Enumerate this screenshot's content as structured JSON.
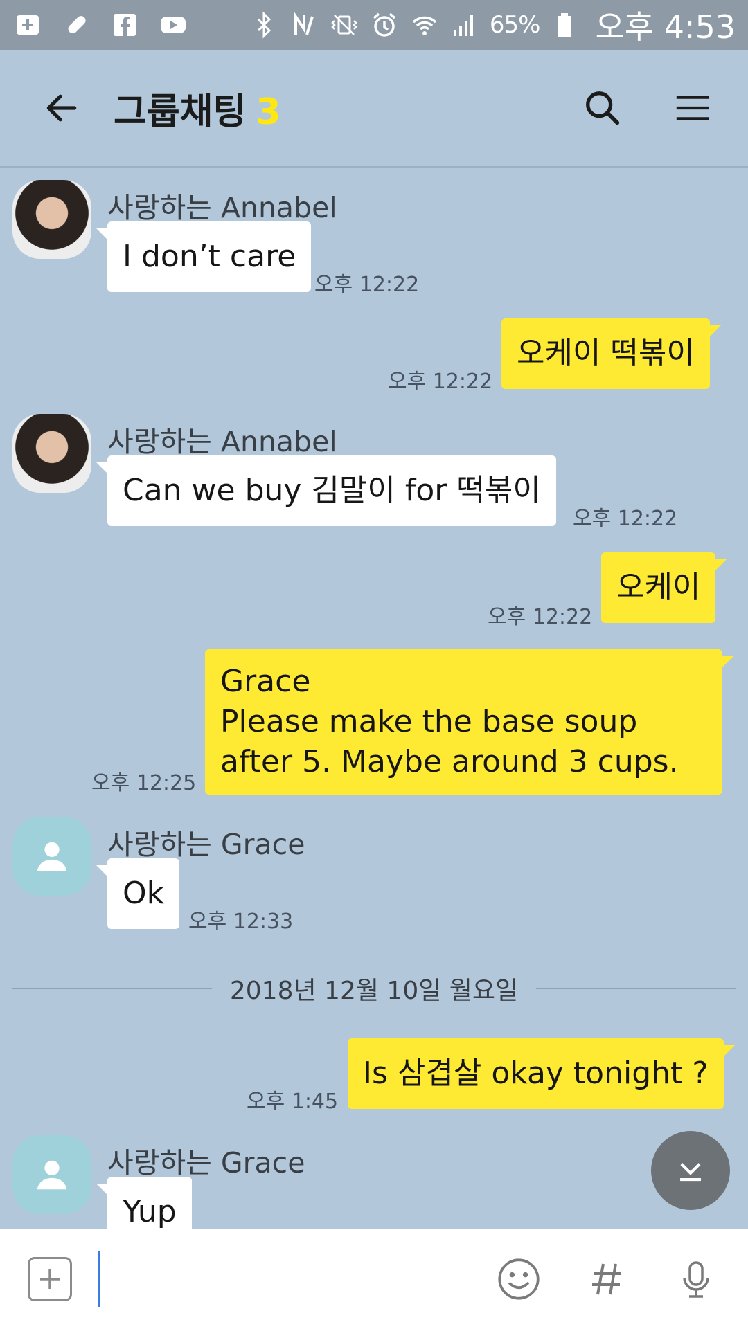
{
  "status_bar": {
    "battery_text": "65%",
    "time": "오후 4:53",
    "icons": [
      "add-box-icon",
      "pill-icon",
      "facebook-icon",
      "youtube-icon",
      "bluetooth-icon",
      "nfc-icon",
      "vibrate-icon",
      "alarm-icon",
      "wifi-icon",
      "signal-icon",
      "battery-icon"
    ]
  },
  "header": {
    "title": "그룹채팅",
    "member_count": "3"
  },
  "messages": [
    {
      "sender": "사랑하는 Annabel",
      "text": "I don’t care",
      "time": "오후 12:22"
    },
    {
      "text": "오케이 떡볶이",
      "time": "오후 12:22"
    },
    {
      "sender": "사랑하는 Annabel",
      "text": "Can we buy 김말이 for 떡볶이",
      "time": "오후 12:22"
    },
    {
      "text": "오케이",
      "time": "오후 12:22"
    },
    {
      "line1": "Grace",
      "line2": "Please make the base soup",
      "line3": "after 5. Maybe around 3 cups.",
      "time": "오후 12:25"
    },
    {
      "sender": "사랑하는 Grace",
      "text": "Ok",
      "time": "오후 12:33"
    },
    {
      "text": "Is 삼겹살 okay tonight ?",
      "time": "오후 1:45"
    },
    {
      "sender": "사랑하는 Grace",
      "text": "Yup"
    }
  ],
  "date_divider": "2018년 12월 10일 월요일",
  "input": {
    "placeholder": ""
  },
  "colors": {
    "chat_background": "#b2c7da",
    "my_bubble": "#ffea33",
    "their_bubble": "#ffffff",
    "member_count": "#ffe812"
  }
}
